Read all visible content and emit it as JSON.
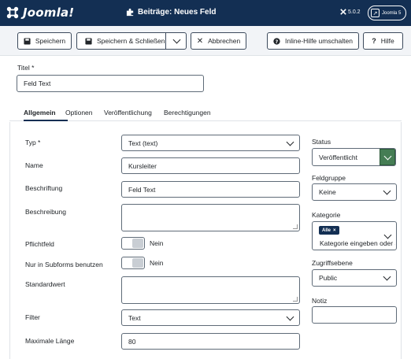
{
  "app": {
    "logo_text": "Joomla!",
    "page_title": "Beiträge: Neues Feld",
    "version": "5.0.2",
    "user_label": "Joomla 5"
  },
  "toolbar": {
    "save": "Speichern",
    "save_close": "Speichern & Schließen",
    "cancel": "Abbrechen",
    "inline_help": "Inline-Hilfe umschalten",
    "help": "Hilfe"
  },
  "title_field": {
    "label": "Titel *",
    "value": "Feld Text"
  },
  "tabs": [
    {
      "label": "Allgemein",
      "active": true
    },
    {
      "label": "Optionen",
      "active": false
    },
    {
      "label": "Veröffentlichung",
      "active": false
    },
    {
      "label": "Berechtigungen",
      "active": false
    }
  ],
  "form": {
    "type": {
      "label": "Typ *",
      "value": "Text (text)"
    },
    "name": {
      "label": "Name",
      "value": "Kursleiter"
    },
    "caption": {
      "label": "Beschriftung",
      "value": "Feld Text"
    },
    "description": {
      "label": "Beschreibung",
      "value": ""
    },
    "required": {
      "label": "Pflichtfeld",
      "state": "Nein"
    },
    "subforms_only": {
      "label": "Nur in Subforms benutzen",
      "state": "Nein"
    },
    "default_value": {
      "label": "Standardwert",
      "value": ""
    },
    "filter": {
      "label": "Filter",
      "value": "Text"
    },
    "max_length": {
      "label": "Maximale Länge",
      "value": "80"
    }
  },
  "sidebar": {
    "status": {
      "label": "Status",
      "value": "Veröffentlicht"
    },
    "field_group": {
      "label": "Feldgruppe",
      "value": "Keine"
    },
    "category": {
      "label": "Kategorie",
      "chip": "Alle",
      "placeholder": "Kategorie eingeben oder au"
    },
    "access": {
      "label": "Zugriffsebene",
      "value": "Public"
    },
    "note": {
      "label": "Notiz",
      "value": ""
    }
  },
  "colors": {
    "header_bg": "#132f53",
    "status_green": "#457d54"
  }
}
